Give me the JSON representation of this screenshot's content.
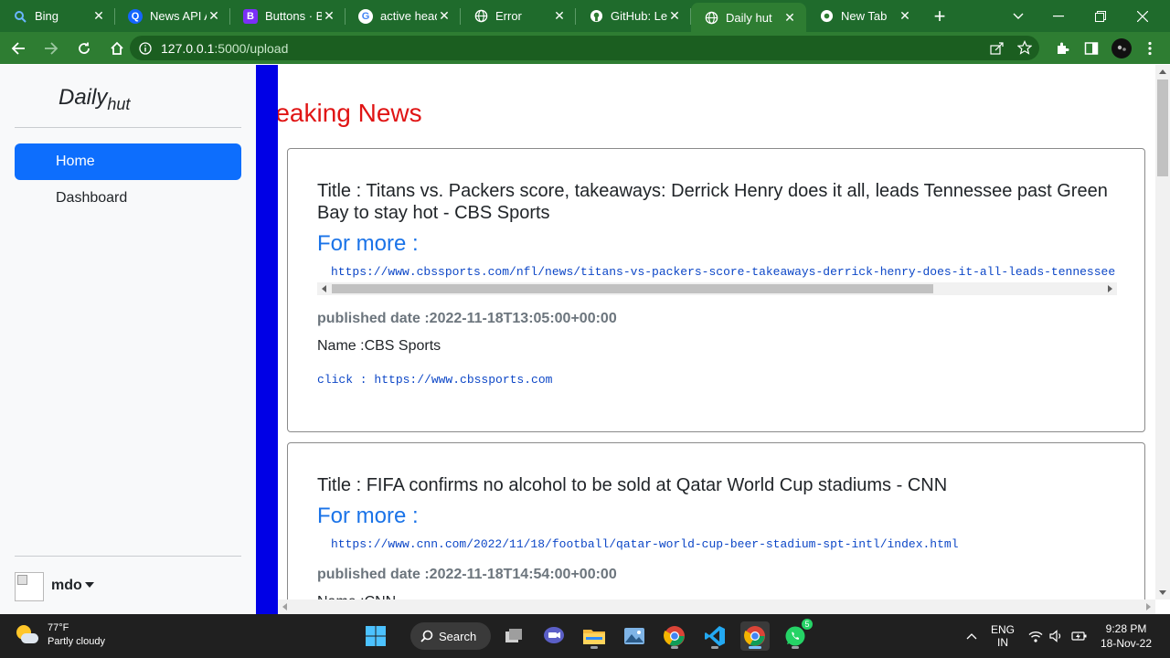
{
  "browser": {
    "tabs": [
      {
        "label": "Bing",
        "icon": "bing-icon",
        "active": false
      },
      {
        "label": "News API A",
        "icon": "newsapi-icon",
        "active": false
      },
      {
        "label": "Buttons · Bo",
        "icon": "bootstrap-icon",
        "active": false
      },
      {
        "label": "active head",
        "icon": "google-icon",
        "active": false
      },
      {
        "label": "Error",
        "icon": "globe-icon",
        "active": false
      },
      {
        "label": "GitHub: Let",
        "icon": "github-icon",
        "active": false
      },
      {
        "label": "Daily hut",
        "icon": "globe-icon",
        "active": true
      },
      {
        "label": "New Tab",
        "icon": "chrome-icon",
        "active": false
      }
    ],
    "url_host": "127.0.0.1",
    "url_path": ":5000/upload",
    "theme_color": "#2e7d32"
  },
  "sidebar": {
    "brand_main": "Daily",
    "brand_sub": "hut",
    "nav": [
      {
        "label": "Home",
        "active": true
      },
      {
        "label": "Dashboard",
        "active": false
      }
    ],
    "user_name": "mdo"
  },
  "main": {
    "headline": "reaking News",
    "articles": [
      {
        "title": "Title : Titans vs. Packers score, takeaways: Derrick Henry does it all, leads Tennessee past Green Bay to stay hot - CBS Sports",
        "for_more": "For more :",
        "url": "https://www.cbssports.com/nfl/news/titans-vs-packers-score-takeaways-derrick-henry-does-it-all-leads-tennessee-p",
        "published": "published date :2022-11-18T13:05:00+00:00",
        "source_name": "Name :CBS Sports",
        "click": "click : https://www.cbssports.com"
      },
      {
        "title": "Title : FIFA confirms no alcohol to be sold at Qatar World Cup stadiums - CNN",
        "for_more": "For more :",
        "url": "https://www.cnn.com/2022/11/18/football/qatar-world-cup-beer-stadium-spt-intl/index.html",
        "published": "published date :2022-11-18T14:54:00+00:00",
        "source_name": "Name :CNN"
      }
    ]
  },
  "taskbar": {
    "weather_temp": "77°F",
    "weather_desc": "Partly cloudy",
    "search_label": "Search",
    "lang_top": "ENG",
    "lang_bottom": "IN",
    "whatsapp_badge": "5",
    "time": "9:28 PM",
    "date": "18-Nov-22"
  }
}
